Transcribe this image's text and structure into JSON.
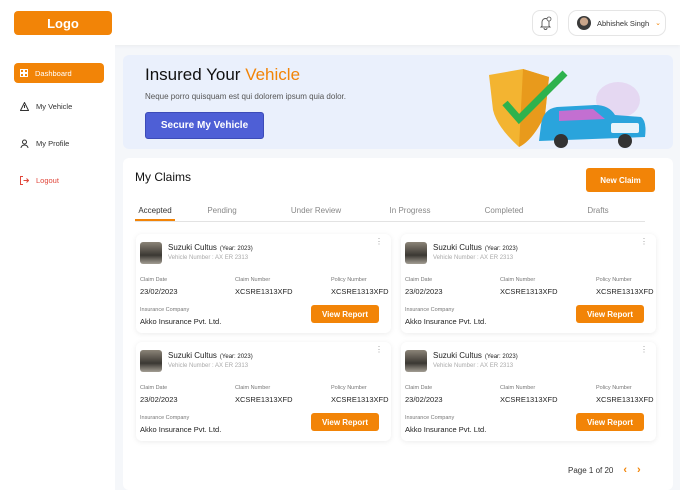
{
  "header": {
    "logo": "Logo",
    "user_name": "Abhishek Singh"
  },
  "sidebar": {
    "items": [
      {
        "label": "Dashboard",
        "icon": "grid-icon"
      },
      {
        "label": "My Vehicle",
        "icon": "warning-icon"
      },
      {
        "label": "My Profile",
        "icon": "user-icon"
      },
      {
        "label": "Logout",
        "icon": "logout-icon"
      }
    ]
  },
  "banner": {
    "title_prefix": "Insured Your ",
    "title_highlight": "Vehicle",
    "subtitle": "Neque porro quisquam est qui dolorem ipsum quia dolor.",
    "button": "Secure My Vehicle"
  },
  "claims": {
    "title": "My Claims",
    "new_claim": "New Claim",
    "tabs": [
      "Accepted",
      "Pending",
      "Under Review",
      "In Progress",
      "Completed",
      "Drafts"
    ],
    "items": [
      {
        "vehicle": "Suzuki Cultus",
        "year": "(Year: 2023)",
        "vehicle_number": "Vehicle Number : AX ER 2313",
        "claim_date_label": "Claim Date",
        "claim_date": "23/02/2023",
        "claim_number_label": "Claim Number",
        "claim_number": "XCSRE1313XFD",
        "policy_number_label": "Policy Number",
        "policy_number": "XCSRE1313XFD",
        "company_label": "Insurance Company",
        "company": "Akko Insurance Pvt. Ltd.",
        "button": "View Report"
      },
      {
        "vehicle": "Suzuki Cultus",
        "year": "(Year: 2023)",
        "vehicle_number": "Vehicle Number : AX ER 2313",
        "claim_date_label": "Claim Date",
        "claim_date": "23/02/2023",
        "claim_number_label": "Claim Number",
        "claim_number": "XCSRE1313XFD",
        "policy_number_label": "Policy Number",
        "policy_number": "XCSRE1313XFD",
        "company_label": "Insurance Company",
        "company": "Akko Insurance Pvt. Ltd.",
        "button": "View Report"
      },
      {
        "vehicle": "Suzuki Cultus",
        "year": "(Year: 2023)",
        "vehicle_number": "Vehicle Number : AX ER 2313",
        "claim_date_label": "Claim Date",
        "claim_date": "23/02/2023",
        "claim_number_label": "Claim Number",
        "claim_number": "XCSRE1313XFD",
        "policy_number_label": "Policy Number",
        "policy_number": "XCSRE1313XFD",
        "company_label": "Insurance Company",
        "company": "Akko Insurance Pvt. Ltd.",
        "button": "View Report"
      },
      {
        "vehicle": "Suzuki Cultus",
        "year": "(Year: 2023)",
        "vehicle_number": "Vehicle Number : AX ER 2313",
        "claim_date_label": "Claim Date",
        "claim_date": "23/02/2023",
        "claim_number_label": "Claim Number",
        "claim_number": "XCSRE1313XFD",
        "policy_number_label": "Policy Number",
        "policy_number": "XCSRE1313XFD",
        "company_label": "Insurance Company",
        "company": "Akko Insurance Pvt. Ltd.",
        "button": "View Report"
      }
    ],
    "pagination": "Page 1 of 20"
  },
  "colors": {
    "accent": "#f28407",
    "primary": "#4e5fd6"
  }
}
